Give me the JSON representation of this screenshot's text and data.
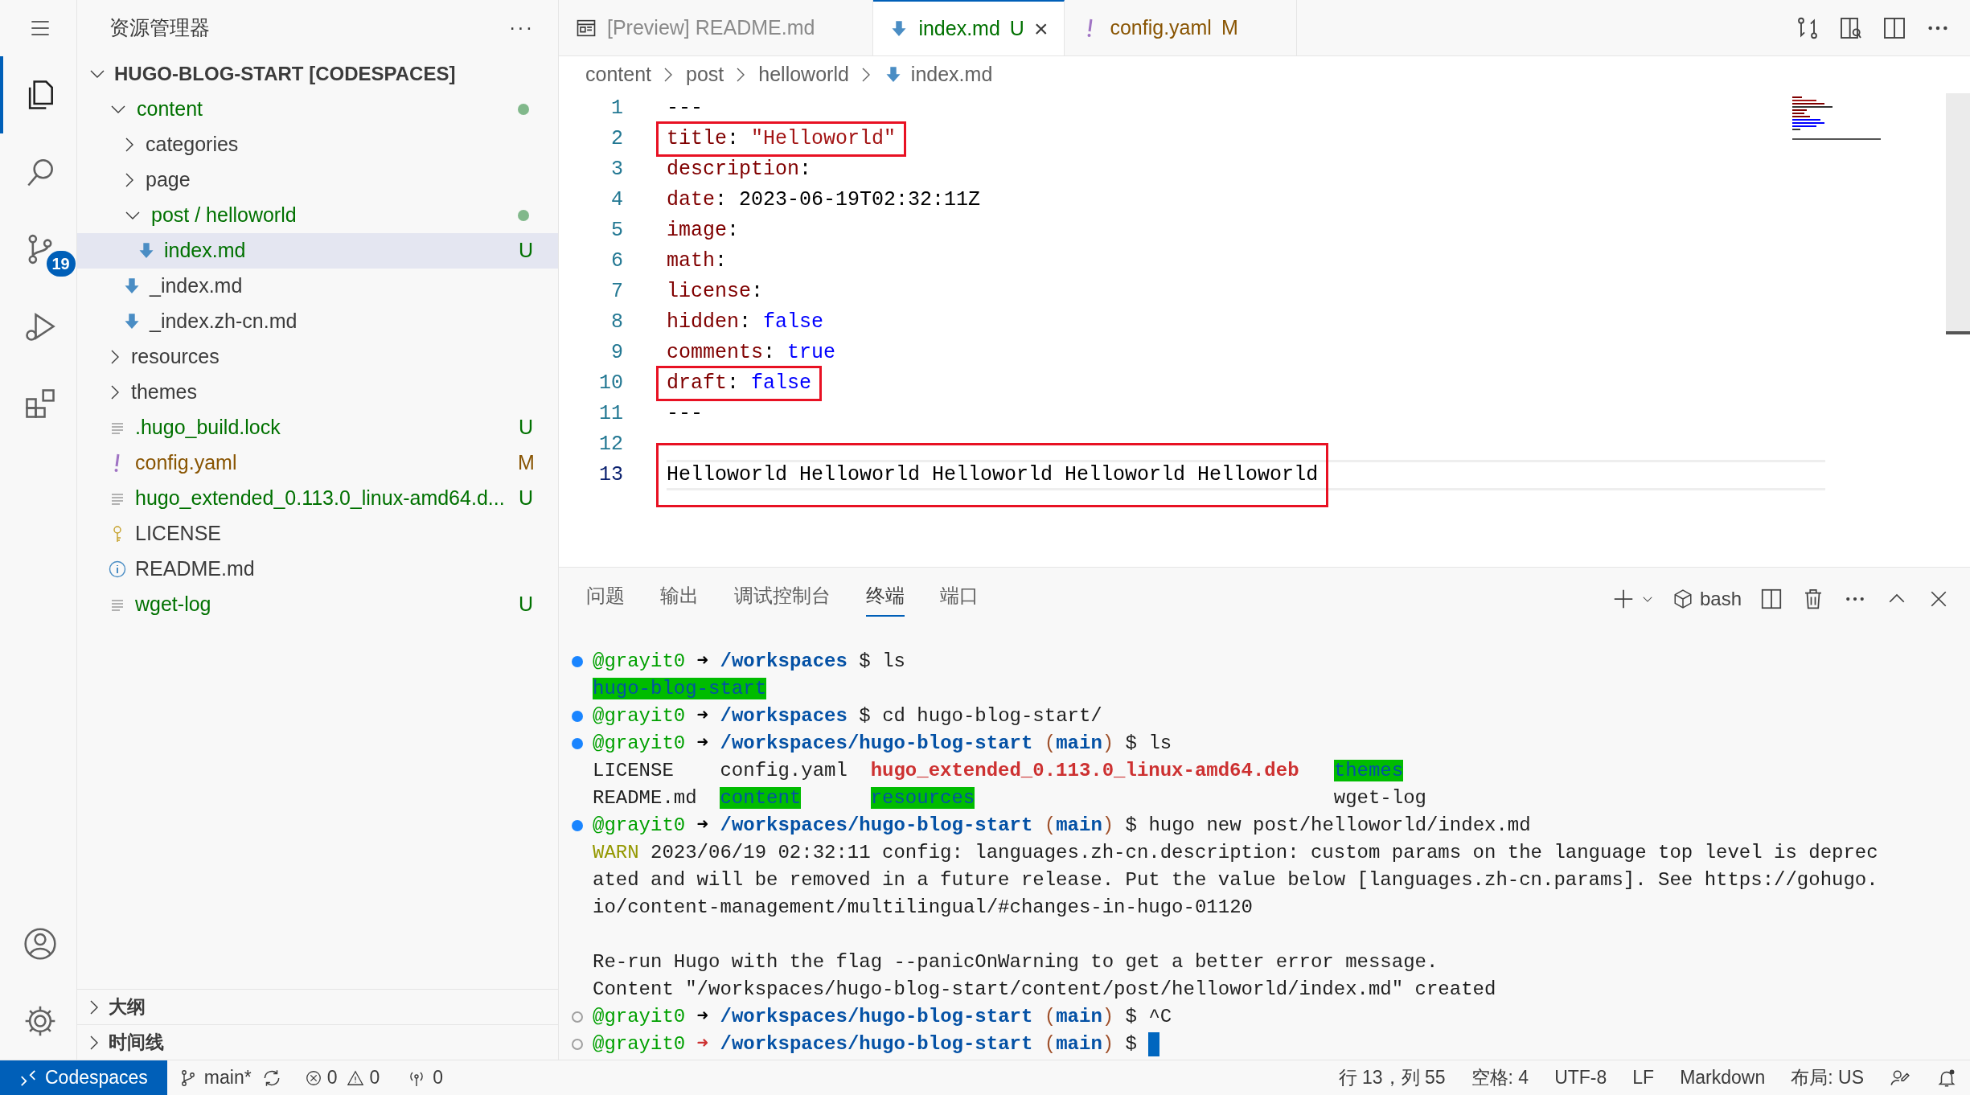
{
  "activity_bar": [
    {
      "kind": "menu",
      "selected": false
    },
    {
      "kind": "files",
      "selected": true
    },
    {
      "kind": "search",
      "selected": false
    },
    {
      "kind": "source-control",
      "selected": false,
      "badge": "19"
    },
    {
      "kind": "run",
      "selected": false
    },
    {
      "kind": "extensions",
      "selected": false
    },
    {
      "kind": "account",
      "selected": false
    },
    {
      "kind": "settings",
      "selected": false
    }
  ],
  "explorer": {
    "title": "资源管理器",
    "more": "···",
    "root": {
      "label": "HUGO-BLOG-START [CODESPACES]",
      "expanded": true
    },
    "tree": [
      {
        "kind": "folder",
        "label": "content",
        "expanded": true,
        "untracked": true,
        "dot": true,
        "children": [
          {
            "kind": "folder",
            "label": "categories",
            "expanded": false,
            "untracked": false,
            "modified": false
          },
          {
            "kind": "folder",
            "label": "page",
            "expanded": false,
            "untracked": false,
            "modified": false
          },
          {
            "kind": "folder",
            "label": "post / helloworld",
            "expanded": true,
            "untracked": true,
            "dot": true,
            "children": [
              {
                "kind": "markdown",
                "label": "index.md",
                "untracked": true,
                "badge": "U",
                "selected": true
              }
            ]
          },
          {
            "kind": "markdown",
            "label": "_index.md",
            "untracked": false,
            "modified": false,
            "selected": false
          },
          {
            "kind": "markdown",
            "label": "_index.zh-cn.md",
            "untracked": false,
            "modified": false,
            "selected": false
          }
        ]
      },
      {
        "kind": "folder",
        "label": "resources",
        "expanded": false,
        "untracked": false,
        "modified": false
      },
      {
        "kind": "folder",
        "label": "themes",
        "expanded": false,
        "untracked": false,
        "modified": false
      },
      {
        "kind": "lines",
        "label": ".hugo_build.lock",
        "untracked": true,
        "badge": "U",
        "selected": false
      },
      {
        "kind": "yaml",
        "label": "config.yaml",
        "untracked": false,
        "modified": true,
        "badge": "M",
        "selected": false
      },
      {
        "kind": "lines",
        "label": "hugo_extended_0.113.0_linux-amd64.d...",
        "untracked": true,
        "badge": "U",
        "selected": false
      },
      {
        "kind": "license",
        "label": "LICENSE",
        "untracked": false,
        "modified": false,
        "selected": false
      },
      {
        "kind": "info",
        "label": "README.md",
        "untracked": false,
        "modified": false,
        "selected": false
      },
      {
        "kind": "lines",
        "label": "wget-log",
        "untracked": true,
        "badge": "U",
        "selected": false
      }
    ],
    "sections": [
      {
        "label": "大纲",
        "expanded": false
      },
      {
        "label": "时间线",
        "expanded": false
      }
    ]
  },
  "tabs": [
    {
      "kind": "preview",
      "label": "[Preview] README.md",
      "untracked": false,
      "modified": false,
      "selected": false
    },
    {
      "kind": "markdown",
      "label": "index.md",
      "badge": "U",
      "untracked": true,
      "selected": true,
      "close": "×"
    },
    {
      "kind": "yaml",
      "label": "config.yaml",
      "badge": "M",
      "untracked": false,
      "modified": true,
      "selected": false
    }
  ],
  "breadcrumbs": [
    {
      "kind": "folder",
      "label": "content"
    },
    {
      "kind": "folder",
      "label": "post"
    },
    {
      "kind": "folder",
      "label": "helloworld"
    },
    {
      "kind": "markdown",
      "label": "index.md"
    }
  ],
  "editor_lines": [
    {
      "number": "1",
      "current": false,
      "boxed": false,
      "tokens": [
        {
          "kind": "punct",
          "text": "---"
        }
      ]
    },
    {
      "number": "2",
      "current": false,
      "boxed": true,
      "tokens": [
        {
          "kind": "key",
          "text": "title"
        },
        {
          "kind": "punct",
          "text": ": "
        },
        {
          "kind": "string",
          "text": "\"Helloworld\""
        }
      ]
    },
    {
      "number": "3",
      "current": false,
      "boxed": false,
      "tokens": [
        {
          "kind": "key",
          "text": "description"
        },
        {
          "kind": "punct",
          "text": ":"
        }
      ]
    },
    {
      "number": "4",
      "current": false,
      "boxed": false,
      "tokens": [
        {
          "kind": "key",
          "text": "date"
        },
        {
          "kind": "punct",
          "text": ": 2023-06-19T02:32:11Z"
        }
      ]
    },
    {
      "number": "5",
      "current": false,
      "boxed": false,
      "tokens": [
        {
          "kind": "key",
          "text": "image"
        },
        {
          "kind": "punct",
          "text": ":"
        }
      ]
    },
    {
      "number": "6",
      "current": false,
      "boxed": false,
      "tokens": [
        {
          "kind": "key",
          "text": "math"
        },
        {
          "kind": "punct",
          "text": ":"
        }
      ]
    },
    {
      "number": "7",
      "current": false,
      "boxed": false,
      "tokens": [
        {
          "kind": "key",
          "text": "license"
        },
        {
          "kind": "punct",
          "text": ":"
        }
      ]
    },
    {
      "number": "8",
      "current": false,
      "boxed": false,
      "tokens": [
        {
          "kind": "key",
          "text": "hidden"
        },
        {
          "kind": "punct",
          "text": ": "
        },
        {
          "kind": "bool",
          "text": "false"
        }
      ]
    },
    {
      "number": "9",
      "current": false,
      "boxed": false,
      "tokens": [
        {
          "kind": "key",
          "text": "comments"
        },
        {
          "kind": "punct",
          "text": ": "
        },
        {
          "kind": "bool",
          "text": "true"
        }
      ]
    },
    {
      "number": "10",
      "current": false,
      "boxed": true,
      "tokens": [
        {
          "kind": "key",
          "text": "draft"
        },
        {
          "kind": "punct",
          "text": ": "
        },
        {
          "kind": "bool",
          "text": "false"
        }
      ]
    },
    {
      "number": "11",
      "current": false,
      "boxed": false,
      "tokens": [
        {
          "kind": "punct",
          "text": "---"
        }
      ]
    },
    {
      "number": "12",
      "current": false
    },
    {
      "number": "13",
      "current": true,
      "boxed": true,
      "tokens": [
        {
          "kind": "punct",
          "text": "Helloworld Helloworld Helloworld Helloworld Helloworld"
        }
      ]
    }
  ],
  "panel": {
    "tabs": [
      {
        "label": "问题",
        "selected": false
      },
      {
        "label": "输出",
        "selected": false
      },
      {
        "label": "调试控制台",
        "selected": false
      },
      {
        "label": "终端",
        "selected": true
      },
      {
        "label": "端口",
        "selected": false
      }
    ],
    "shell": "bash"
  },
  "terminal": [
    {
      "kind": "text",
      "command": true,
      "succeeded": true,
      "segments": [
        {
          "kind": "user",
          "text": "@grayit0"
        },
        {
          "kind": "arrow",
          "text": " ➜ "
        },
        {
          "kind": "path",
          "text": "/workspaces"
        },
        {
          "kind": "plain",
          "text": " $ ls"
        }
      ]
    },
    {
      "kind": "text",
      "segments": [
        {
          "kind": "dir",
          "text": "hugo-blog-start"
        }
      ]
    },
    {
      "kind": "text",
      "command": true,
      "succeeded": true,
      "segments": [
        {
          "kind": "user",
          "text": "@grayit0"
        },
        {
          "kind": "arrow",
          "text": " ➜ "
        },
        {
          "kind": "path",
          "text": "/workspaces"
        },
        {
          "kind": "plain",
          "text": " $ cd hugo-blog-start/"
        }
      ]
    },
    {
      "kind": "text",
      "command": true,
      "succeeded": true,
      "segments": [
        {
          "kind": "user",
          "text": "@grayit0"
        },
        {
          "kind": "arrow",
          "text": " ➜ "
        },
        {
          "kind": "path",
          "text": "/workspaces/hugo-blog-start"
        },
        {
          "kind": "paren",
          "text": " ("
        },
        {
          "kind": "branch",
          "text": "main"
        },
        {
          "kind": "paren",
          "text": ")"
        },
        {
          "kind": "plain",
          "text": " $ ls"
        }
      ]
    },
    {
      "kind": "columns",
      "segments": [
        {
          "kind": "plain",
          "text": "LICENSE"
        },
        {
          "kind": "plain",
          "text": "config.yaml"
        },
        {
          "kind": "package",
          "text": "hugo_extended_0.113.0_linux-amd64.deb"
        },
        {
          "kind": "dir",
          "text": "themes"
        }
      ]
    },
    {
      "kind": "columns",
      "segments": [
        {
          "kind": "plain",
          "text": "README.md"
        },
        {
          "kind": "dir",
          "text": "content"
        },
        {
          "kind": "dir",
          "text": "resources"
        },
        {
          "kind": "plain",
          "text": "wget-log"
        }
      ]
    },
    {
      "kind": "text",
      "command": true,
      "succeeded": true,
      "segments": [
        {
          "kind": "user",
          "text": "@grayit0"
        },
        {
          "kind": "arrow",
          "text": " ➜ "
        },
        {
          "kind": "path",
          "text": "/workspaces/hugo-blog-start"
        },
        {
          "kind": "paren",
          "text": " ("
        },
        {
          "kind": "branch",
          "text": "main"
        },
        {
          "kind": "paren",
          "text": ")"
        },
        {
          "kind": "plain",
          "text": " $ hugo new post/helloworld/index.md"
        }
      ]
    },
    {
      "kind": "text",
      "segments": [
        {
          "kind": "warn",
          "text": "WARN"
        },
        {
          "kind": "plain",
          "text": " 2023/06/19 02:32:11 config: languages.zh-cn.description: custom params on the language top level is deprec"
        }
      ]
    },
    {
      "kind": "text",
      "segments": [
        {
          "kind": "plain",
          "text": "ated and will be removed in a future release. Put the value below [languages.zh-cn.params]. See https://gohugo."
        }
      ]
    },
    {
      "kind": "text",
      "segments": [
        {
          "kind": "plain",
          "text": "io/content-management/multilingual/#changes-in-hugo-01120"
        }
      ]
    },
    {
      "kind": "blank"
    },
    {
      "kind": "text",
      "segments": [
        {
          "kind": "plain",
          "text": "Re-run Hugo with the flag --panicOnWarning to get a better error message."
        }
      ]
    },
    {
      "kind": "text",
      "segments": [
        {
          "kind": "plain",
          "text": "Content \"/workspaces/hugo-blog-start/content/post/helloworld/index.md\" created"
        }
      ]
    },
    {
      "kind": "text",
      "command": true,
      "succeeded": false,
      "segments": [
        {
          "kind": "user",
          "text": "@grayit0"
        },
        {
          "kind": "arrow",
          "text": " ➜ "
        },
        {
          "kind": "path",
          "text": "/workspaces/hugo-blog-start"
        },
        {
          "kind": "paren",
          "text": " ("
        },
        {
          "kind": "branch",
          "text": "main"
        },
        {
          "kind": "paren",
          "text": ")"
        },
        {
          "kind": "plain",
          "text": " $ ^C"
        }
      ]
    },
    {
      "kind": "text",
      "command": true,
      "succeeded": false,
      "cursor": true,
      "segments": [
        {
          "kind": "user",
          "text": "@grayit0"
        },
        {
          "kind": "arrow_error",
          "text": " ➜ "
        },
        {
          "kind": "path",
          "text": "/workspaces/hugo-blog-start"
        },
        {
          "kind": "paren",
          "text": " ("
        },
        {
          "kind": "branch",
          "text": "main"
        },
        {
          "kind": "paren",
          "text": ")"
        },
        {
          "kind": "plain",
          "text": " $ "
        }
      ]
    }
  ],
  "status_bar": {
    "remote": "Codespaces",
    "branch": "main*",
    "errors": "0",
    "warnings": "0",
    "ports": "0",
    "right": [
      "行 13，列 55",
      "空格: 4",
      "UTF-8",
      "LF",
      "Markdown",
      "布局: US"
    ]
  }
}
